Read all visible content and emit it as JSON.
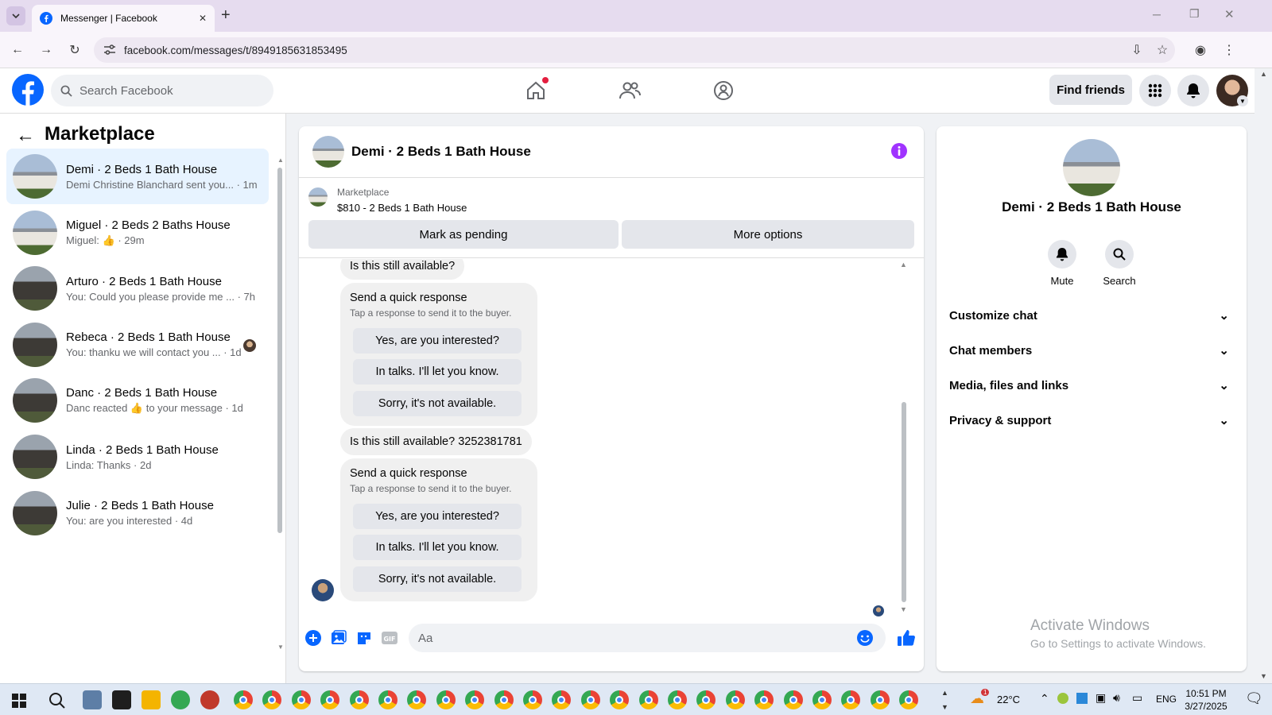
{
  "browser": {
    "tab_title": "Messenger | Facebook",
    "url": "facebook.com/messages/t/8949185631853495",
    "new_tab": "+",
    "close_tab": "✕"
  },
  "fb": {
    "search_placeholder": "Search Facebook",
    "find_friends": "Find friends"
  },
  "left": {
    "title": "Marketplace",
    "conversations": [
      {
        "name": "Demi · 2 Beds 1 Bath House",
        "sub": "Demi Christine Blanchard sent you... · 1m"
      },
      {
        "name": "Miguel · 2 Beds 2 Baths House",
        "sub": "Miguel: 👍 · 29m"
      },
      {
        "name": "Arturo · 2 Beds 1 Bath House",
        "sub": "You: Could you please provide me ... · 7h"
      },
      {
        "name": "Rebeca · 2 Beds 1 Bath House",
        "sub": "You: thanku we will contact you ... · 1d"
      },
      {
        "name": "Danc · 2 Beds 1 Bath House",
        "sub": "Danc reacted 👍 to your message · 1d"
      },
      {
        "name": "Linda · 2 Beds 1 Bath House",
        "sub": "Linda: Thanks · 2d"
      },
      {
        "name": "Julie · 2 Beds 1 Bath House",
        "sub": "You: are you interested · 4d"
      }
    ]
  },
  "chat": {
    "title": "Demi · 2 Beds 1 Bath House",
    "marketplace_label": "Marketplace",
    "listing": "$810 - 2 Beds 1 Bath House",
    "mark_pending": "Mark as pending",
    "more_options": "More options",
    "msg1": "Is this still available?",
    "qr_title": "Send a quick response",
    "qr_sub": "Tap a response to send it to the buyer.",
    "qr_options": [
      "Yes, are you interested?",
      "In talks. I'll let you know.",
      "Sorry, it's not available."
    ],
    "msg2": "Is this still available? 3252381781",
    "composer_placeholder": "Aa"
  },
  "info": {
    "name": "Demi · 2 Beds 1 Bath House",
    "mute": "Mute",
    "search": "Search",
    "sections": [
      "Customize chat",
      "Chat members",
      "Media, files and links",
      "Privacy & support"
    ]
  },
  "watermark": {
    "line1": "Activate Windows",
    "line2": "Go to Settings to activate Windows."
  },
  "taskbar": {
    "weather": "22°C",
    "lang": "ENG",
    "time": "10:51 PM",
    "date": "3/27/2025",
    "weather_badge": "1"
  },
  "colors": {
    "fb_blue": "#0866ff",
    "messenger_purple": "#a033ff"
  }
}
